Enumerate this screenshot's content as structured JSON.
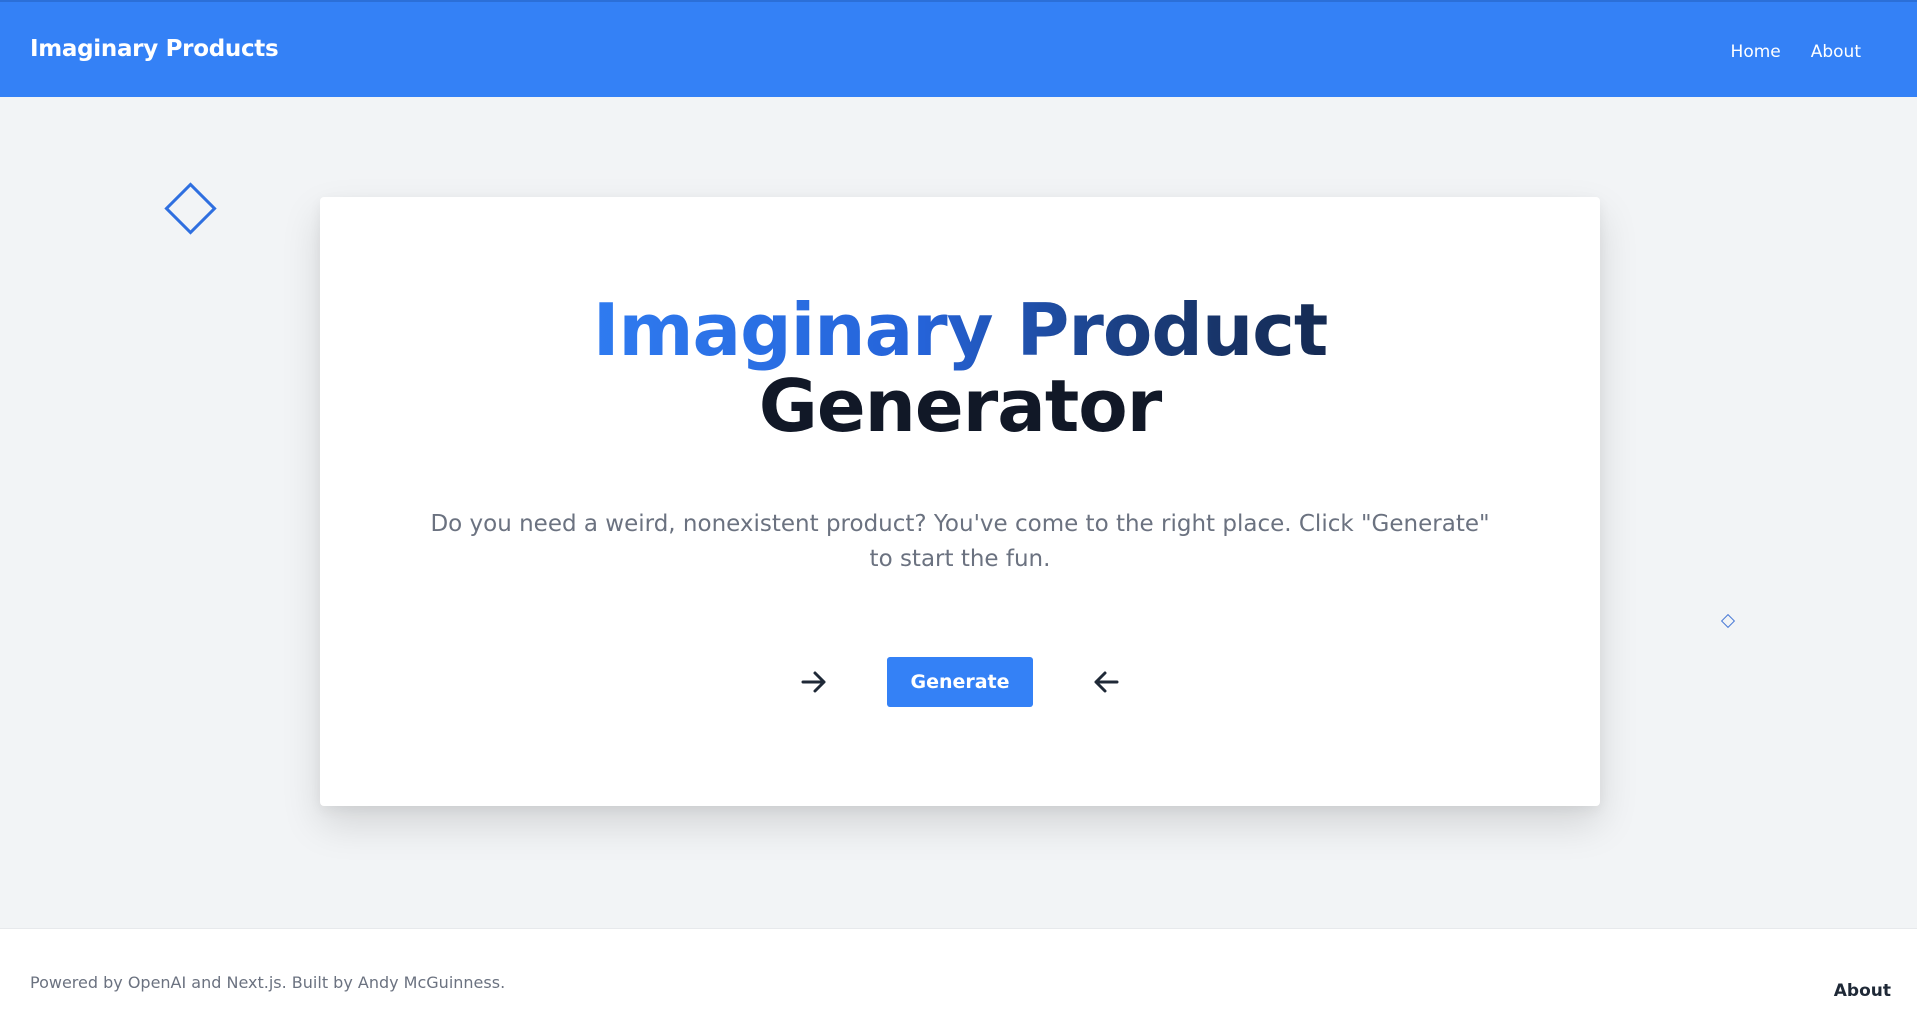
{
  "header": {
    "brand": "Imaginary Products",
    "nav": [
      {
        "label": "Home"
      },
      {
        "label": "About"
      }
    ]
  },
  "hero": {
    "title_line1": "Imaginary Product",
    "title_line2": "Generator",
    "subtitle": "Do you need a weird, nonexistent product? You've come to the right place. Click \"Generate\" to start the fun.",
    "generate_label": "Generate",
    "left_icon": "arrow-right-icon",
    "right_icon": "arrow-left-icon"
  },
  "footer": {
    "credit": "Powered by OpenAI and Next.js. Built by Andy McGuinness.",
    "about_label": "About"
  },
  "colors": {
    "primary": "#3481f6",
    "background": "#f2f4f6",
    "heading_dark": "#111827",
    "muted_text": "#6b7280"
  }
}
